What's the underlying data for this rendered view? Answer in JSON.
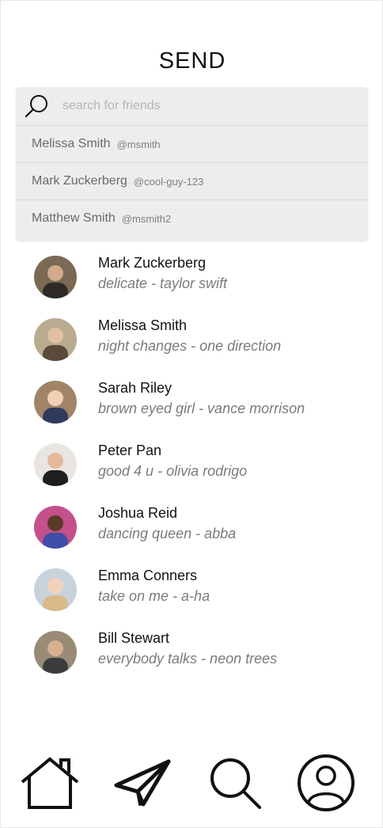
{
  "header": {
    "title": "SEND"
  },
  "search": {
    "placeholder": "search for friends",
    "icon": "search-icon",
    "suggestions": [
      {
        "name": "Melissa Smith",
        "handle": "@msmith"
      },
      {
        "name": "Mark Zuckerberg",
        "handle": "@cool-guy-123"
      },
      {
        "name": "Matthew Smith",
        "handle": "@msmith2"
      }
    ]
  },
  "friends": [
    {
      "name": "Mark Zuckerberg",
      "song": "delicate - taylor swift",
      "avatar_colors": [
        "#7a6a55",
        "#2e2a26"
      ]
    },
    {
      "name": "Melissa Smith",
      "song": "night changes - one direction",
      "avatar_colors": [
        "#b9ab8f",
        "#5b4a3a"
      ]
    },
    {
      "name": "Sarah Riley",
      "song": "brown eyed girl - vance morrison",
      "avatar_colors": [
        "#a08468",
        "#2f3b5c"
      ]
    },
    {
      "name": "Peter Pan",
      "song": "good 4 u - olivia rodrigo",
      "avatar_colors": [
        "#e9e5e1",
        "#1e1e1e"
      ]
    },
    {
      "name": "Joshua Reid",
      "song": "dancing queen - abba",
      "avatar_colors": [
        "#c4508c",
        "#3f4ea6"
      ]
    },
    {
      "name": "Emma Conners",
      "song": "take on me - a-ha",
      "avatar_colors": [
        "#c8d2dc",
        "#d8b98a"
      ]
    },
    {
      "name": "Bill Stewart",
      "song": "everybody talks - neon trees",
      "avatar_colors": [
        "#9a8b76",
        "#3c3c3c"
      ]
    }
  ],
  "nav": {
    "items": [
      {
        "icon": "home-icon"
      },
      {
        "icon": "send-icon"
      },
      {
        "icon": "search-icon"
      },
      {
        "icon": "profile-icon"
      }
    ]
  }
}
